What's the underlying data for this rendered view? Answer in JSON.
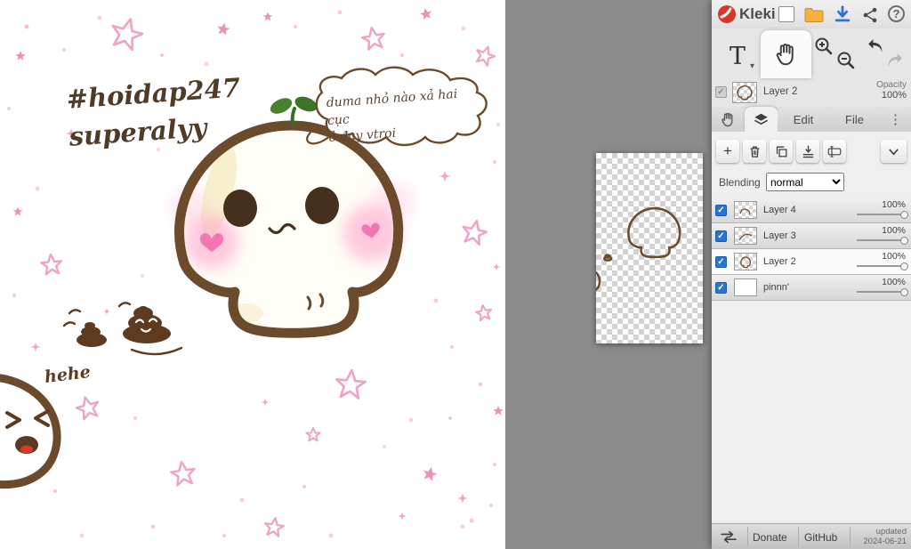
{
  "app": {
    "title": "Kleki"
  },
  "icons": {
    "help": "?",
    "check": "✓",
    "plus": "+",
    "dots_vertical": "⋮",
    "chevron_small": "▾",
    "text_tool": "T"
  },
  "current_layer": {
    "name": "Layer 2",
    "opacity_label": "Opacity",
    "opacity_value": "100%"
  },
  "tabs": {
    "edit": "Edit",
    "file": "File"
  },
  "blending": {
    "label": "Blending",
    "value": "normal"
  },
  "layers": [
    {
      "name": "Layer 4",
      "opacity": "100%"
    },
    {
      "name": "Layer 3",
      "opacity": "100%"
    },
    {
      "name": "Layer 2",
      "opacity": "100%"
    },
    {
      "name": "pinnn'",
      "opacity": "100%"
    }
  ],
  "footer": {
    "donate": "Donate",
    "github": "GitHub",
    "updated_label": "updated",
    "updated_date": "2024-06-21"
  },
  "canvas": {
    "tag_line1": "#hoidap247",
    "tag_line2": "superalyy",
    "bubble_line1": "duma nhỏ nào xả hai cục",
    "bubble_line2": "ở đay vtroi",
    "laugh": "hehe"
  }
}
